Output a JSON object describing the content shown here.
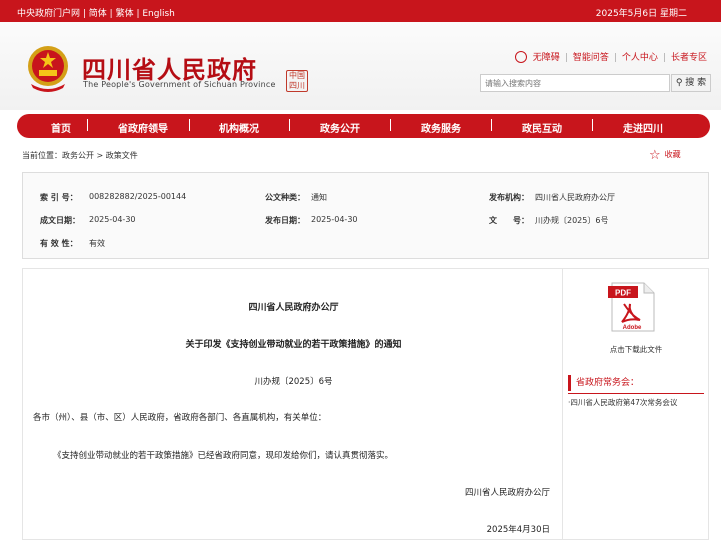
{
  "topbar": {
    "links": [
      "中央政府门户网",
      "简体",
      "繁体",
      "English"
    ],
    "date": "2025年5月6日 星期二"
  },
  "header": {
    "title": "四川省人民政府",
    "subtitle": "The People's Government of Sichuan Province",
    "seal": "中国四川",
    "utility": [
      "无障碍",
      "智能问答",
      "个人中心",
      "长者专区"
    ],
    "search_placeholder": "请输入搜索内容",
    "search_button": "搜 索"
  },
  "nav": {
    "items": [
      "首页",
      "省政府领导",
      "机构概况",
      "政务公开",
      "政务服务",
      "政民互动",
      "走进四川"
    ]
  },
  "breadcrumb": "当前位置：政务公开 > 政策文件",
  "favorite": "收藏",
  "meta": {
    "index_label": "索 引 号：",
    "index_value": "008282882/2025-00144",
    "category_label": "公文种类：",
    "category_value": "通知",
    "issuer_label": "发布机构：",
    "issuer_value": "四川省人民政府办公厅",
    "created_label": "成文日期：",
    "created_value": "2025-04-30",
    "published_label": "发布日期：",
    "published_value": "2025-04-30",
    "docno_label": "文　　号：",
    "docno_value": "川办规〔2025〕6号",
    "validity_label": "有 效 性：",
    "validity_value": "有效"
  },
  "document": {
    "org": "四川省人民政府办公厅",
    "title": "关于印发《支持创业带动就业的若干政策措施》的通知",
    "doc_no": "川办规〔2025〕6号",
    "addressees": "各市（州）、县（市、区）人民政府，省政府各部门、各直属机构，有关单位：",
    "body": "《支持创业带动就业的若干政策措施》已经省政府同意，现印发给你们，请认真贯彻落实。",
    "signature": "四川省人民政府办公厅",
    "date": "2025年4月30日"
  },
  "sidebar": {
    "pdf_label": "PDF",
    "pdf_brand": "Adobe",
    "download": "点击下载此文件",
    "section_title": "省政府常务会：",
    "items": [
      "·四川省人民政府第47次常务会议"
    ]
  }
}
